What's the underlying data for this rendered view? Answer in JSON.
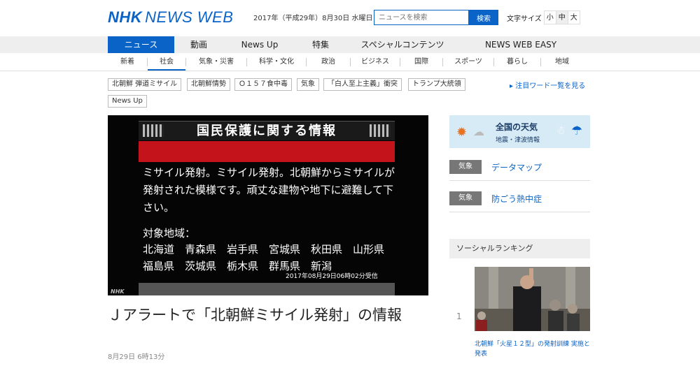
{
  "header": {
    "logo_nhk": "NHK",
    "logo_news": "NEWS WEB",
    "date": "2017年（平成29年）8月30日 水曜日",
    "search_placeholder": "ニュースを検索",
    "search_button": "検索",
    "font_size_label": "文字サイズ",
    "font_sizes": [
      "小",
      "中",
      "大"
    ]
  },
  "main_nav": [
    "ニュース",
    "動画",
    "News Up",
    "特集",
    "スペシャルコンテンツ",
    "NEWS WEB EASY"
  ],
  "sub_nav": [
    "新着",
    "社会",
    "気象・災害",
    "科学・文化",
    "政治",
    "ビジネス",
    "国際",
    "スポーツ",
    "暮らし",
    "地域"
  ],
  "tags": [
    "北朝鮮 弾道ミサイル",
    "北朝鮮情勢",
    "Ｏ１５７食中毒",
    "気象",
    "「白人至上主義」衝突",
    "トランプ大統領",
    "News Up"
  ],
  "tags_more": "注目ワード一覧を見る",
  "hero": {
    "title": "国民保護に関する情報",
    "message": "ミサイル発射。ミサイル発射。北朝鮮からミサイルが発射された模様です。頑丈な建物や地下に避難して下さい。",
    "region_label": "対象地域：",
    "regions": "北海道　青森県　岩手県　宮城県　秋田県　山形県　福島県　茨城県　栃木県　群馬県　新潟",
    "stamp": "2017年08月29日06時02分受信",
    "logo": "NHK"
  },
  "article": {
    "headline": "Ｊアラートで「北朝鮮ミサイル発射」の情報",
    "time": "8月29日 6時13分"
  },
  "sidebar": {
    "weather_title": "全国の天気",
    "weather_sub": "地震・津波情報",
    "links": [
      {
        "badge": "気象",
        "text": "データマップ"
      },
      {
        "badge": "気象",
        "text": "防ごう熱中症"
      }
    ],
    "social_heading": "ソーシャルランキング",
    "ranking": [
      {
        "rank": "1",
        "caption": "北朝鮮「火星１２型」の発射訓練 実施と発表"
      }
    ]
  }
}
